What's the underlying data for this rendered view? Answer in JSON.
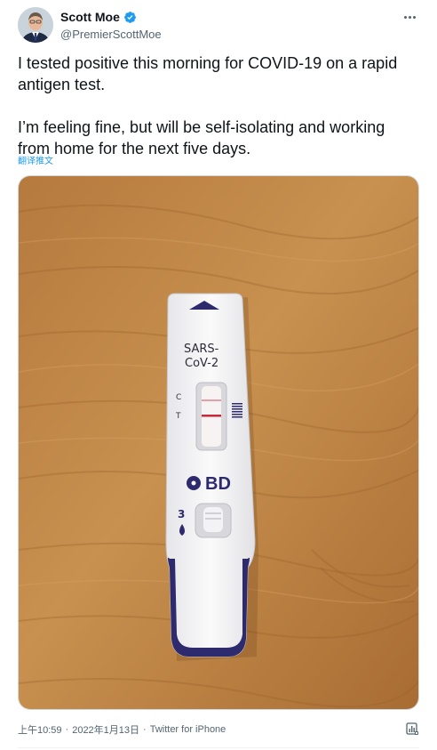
{
  "author": {
    "display_name": "Scott Moe",
    "handle": "@PremierScottMoe",
    "verified": true
  },
  "tweet": {
    "text": "I tested positive this morning for COVID-19 on a rapid antigen test.\n\nI’m feeling fine, but will be self-isolating and working from home for the next five days.",
    "translate_label": "翻译推文"
  },
  "media": {
    "test_label_line1": "SARS-",
    "test_label_line2": "CoV-2",
    "control_label": "C",
    "test_line_label": "T",
    "brand_label": "BD",
    "sample_label": "3"
  },
  "footer": {
    "time": "上午10:59",
    "separator1": "·",
    "date": "2022年1月13日",
    "separator2": "·",
    "source": "Twitter for iPhone"
  },
  "colors": {
    "link": "#1d9bf0",
    "verified": "#1d9bf0",
    "test_strip_accent": "#2e2a6e"
  },
  "icons": {
    "verified": "verified-badge-icon",
    "more": "more-icon",
    "analytics": "analytics-icon"
  }
}
